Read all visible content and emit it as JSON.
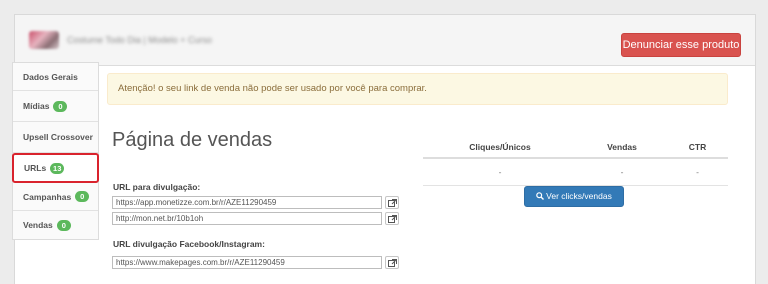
{
  "header": {
    "product_title": "Costume Todo Dia | Modelo + Curso",
    "report_button": "Denunciar esse produto"
  },
  "sidebar": {
    "items": [
      {
        "label": "Dados Gerais",
        "badge": ""
      },
      {
        "label": "Mídias",
        "badge": "0"
      },
      {
        "label": "Upsell Crossover",
        "badge": ""
      },
      {
        "label": "URLs",
        "badge": "13"
      },
      {
        "label": "Campanhas",
        "badge": "0"
      },
      {
        "label": "Vendas",
        "badge": "0"
      }
    ],
    "active_item": "URLs"
  },
  "alert": {
    "text": "Atenção! o seu link de venda não pode ser usado por você para comprar."
  },
  "main": {
    "title": "Página de vendas",
    "url_label": "URL para divulgação:",
    "url_1": "https://app.monetizze.com.br/r/AZE11290459",
    "url_2": "http://mon.net.br/10b1oh",
    "fb_label": "URL divulgação Facebook/Instagram:",
    "fb_url": "https://www.makepages.com.br/r/AZE11290459"
  },
  "stats": {
    "headers": [
      "Cliques/Únicos",
      "Vendas",
      "CTR"
    ],
    "row": [
      "-",
      "-",
      "-"
    ],
    "button_label": "Ver clicks/vendas"
  },
  "colors": {
    "danger": "#d9534f",
    "badge": "#5cb85c",
    "primary": "#337ab7",
    "alert_bg": "#fcf8e3",
    "active_outline": "#d9232d"
  }
}
